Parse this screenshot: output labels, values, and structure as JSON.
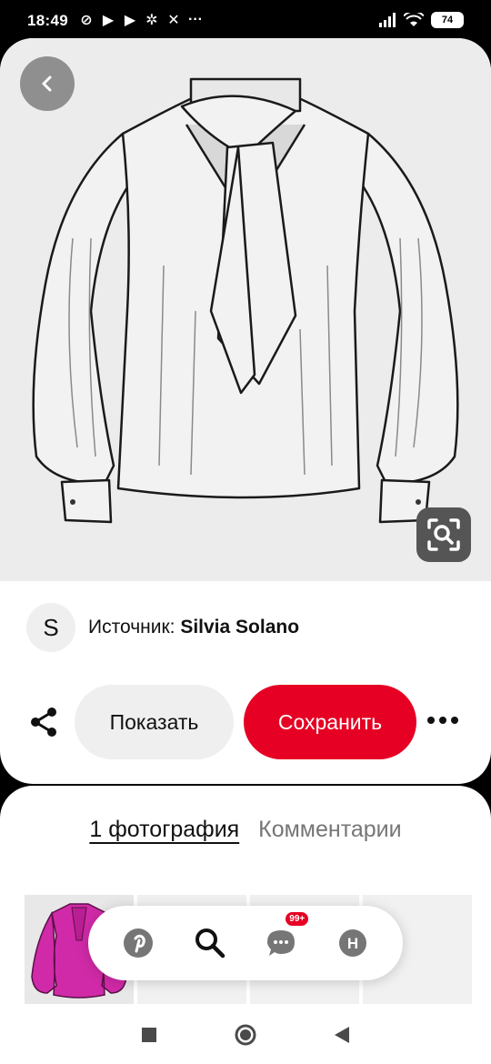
{
  "status_bar": {
    "time": "18:49",
    "battery": "74"
  },
  "pin": {
    "source_label": "Источник:",
    "source_name": "Silvia Solano",
    "avatar_letter": "S"
  },
  "actions": {
    "show_label": "Показать",
    "save_label": "Сохранить"
  },
  "tabs": {
    "photo": "1 фотография",
    "comments": "Комментарии"
  },
  "bottom_nav": {
    "badge": "99+",
    "profile_letter": "H"
  },
  "colors": {
    "accent": "#e60023",
    "image_bg": "#ececec",
    "thumb_garment": "#d12aa8"
  }
}
